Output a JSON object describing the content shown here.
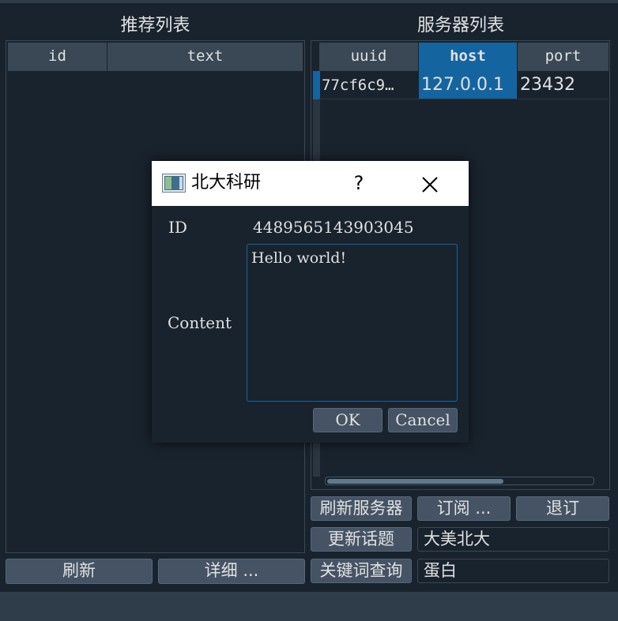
{
  "left": {
    "title": "推荐列表",
    "columns": [
      "id",
      "text"
    ],
    "buttons": {
      "refresh": "刷新",
      "detail": "详细 ..."
    }
  },
  "right": {
    "title": "服务器列表",
    "columns": [
      "uuid",
      "host",
      "port"
    ],
    "rows": [
      {
        "uuid": "77cf6c9…",
        "host": "127.0.0.1",
        "port": "23432"
      }
    ],
    "buttons": {
      "refresh_servers": "刷新服务器",
      "subscribe": "订阅 ...",
      "unsubscribe": "退订",
      "update_topic": "更新话题",
      "keyword_query": "关键词查询"
    },
    "fields": {
      "topic": "大美北大",
      "keyword": "蛋白"
    }
  },
  "dialog": {
    "title": "北大科研",
    "help": "?",
    "close": "✕",
    "id_label": "ID",
    "id_value": "4489565143903045",
    "content_label": "Content",
    "content_value": "Hello world!",
    "ok": "OK",
    "cancel": "Cancel"
  },
  "colors": {
    "background": "#19232d",
    "selection": "#1464a0",
    "button": "#455364"
  }
}
